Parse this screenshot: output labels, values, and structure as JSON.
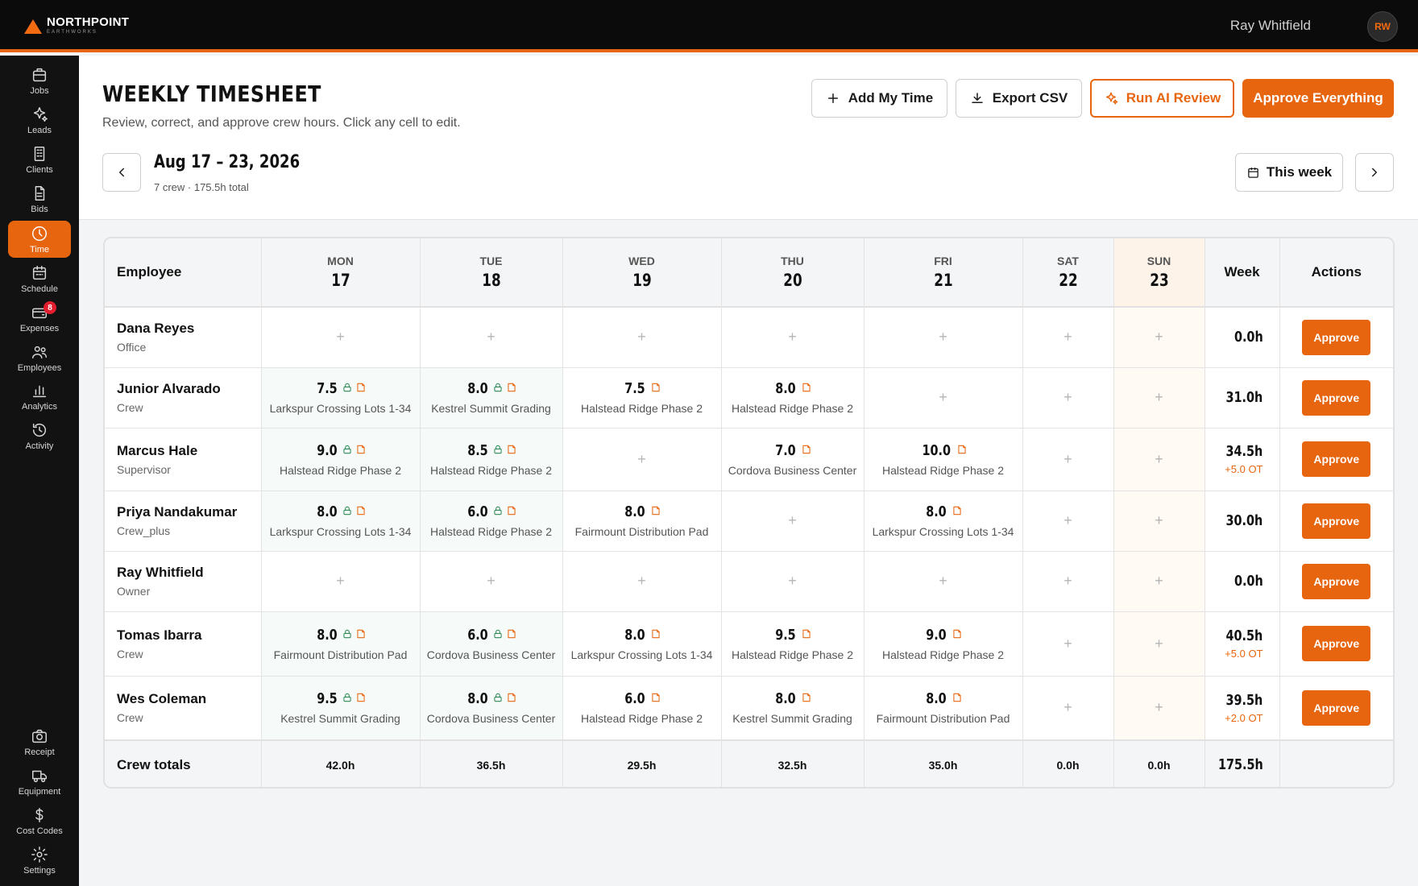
{
  "brand": {
    "name": "NORTHPOINT",
    "sub": "EARTHWORKS",
    "accent": "#e8650f"
  },
  "user": {
    "name": "Ray Whitfield",
    "initials": "RW"
  },
  "sidebar": {
    "items": [
      {
        "label": "Jobs",
        "icon": "briefcase-icon"
      },
      {
        "label": "Leads",
        "icon": "sparkle-icon"
      },
      {
        "label": "Clients",
        "icon": "building-icon"
      },
      {
        "label": "Bids",
        "icon": "document-icon"
      },
      {
        "label": "Time",
        "icon": "clock-icon",
        "active": true
      },
      {
        "label": "Schedule",
        "icon": "calendar-icon"
      },
      {
        "label": "Expenses",
        "icon": "wallet-icon",
        "badge": "8"
      },
      {
        "label": "Employees",
        "icon": "users-icon"
      },
      {
        "label": "Analytics",
        "icon": "bar-chart-icon"
      },
      {
        "label": "Activity",
        "icon": "history-icon"
      }
    ],
    "bottom": [
      {
        "label": "Receipt",
        "icon": "camera-icon"
      },
      {
        "label": "Equipment",
        "icon": "truck-icon"
      },
      {
        "label": "Cost Codes",
        "icon": "dollar-icon"
      },
      {
        "label": "Settings",
        "icon": "gear-icon"
      }
    ]
  },
  "page": {
    "title": "WEEKLY TIMESHEET",
    "subtitle": "Review, correct, and approve crew hours. Click any cell to edit.",
    "buttons": {
      "add_time": "Add My Time",
      "export": "Export CSV",
      "ai_review": "Run AI Review",
      "approve_all": "Approve Everything"
    },
    "date_range": "Aug 17 – 23, 2026",
    "date_meta": "7 crew · 175.5h total",
    "this_week": "This week"
  },
  "table": {
    "headers": {
      "employee": "Employee",
      "week": "Week",
      "actions": "Actions",
      "days": [
        {
          "name": "MON",
          "num": "17"
        },
        {
          "name": "TUE",
          "num": "18"
        },
        {
          "name": "WED",
          "num": "19"
        },
        {
          "name": "THU",
          "num": "20"
        },
        {
          "name": "FRI",
          "num": "21"
        },
        {
          "name": "SAT",
          "num": "22"
        },
        {
          "name": "SUN",
          "num": "23"
        }
      ]
    },
    "add_symbol": "+",
    "approve_label": "Approve",
    "rows": [
      {
        "name": "Dana Reyes",
        "role": "Office",
        "week": "0.0h",
        "ot": "",
        "days": [
          null,
          null,
          null,
          null,
          null,
          null,
          null
        ]
      },
      {
        "name": "Junior Alvarado",
        "role": "Crew",
        "week": "31.0h",
        "ot": "",
        "days": [
          {
            "h": "7.5",
            "job": "Larkspur Crossing Lots 1-34",
            "locked": true
          },
          {
            "h": "8.0",
            "job": "Kestrel Summit Grading",
            "locked": true
          },
          {
            "h": "7.5",
            "job": "Halstead Ridge Phase 2",
            "locked": false
          },
          {
            "h": "8.0",
            "job": "Halstead Ridge Phase 2",
            "locked": false
          },
          null,
          null,
          null
        ]
      },
      {
        "name": "Marcus Hale",
        "role": "Supervisor",
        "week": "34.5h",
        "ot": "+5.0 OT",
        "days": [
          {
            "h": "9.0",
            "job": "Halstead Ridge Phase 2",
            "locked": true
          },
          {
            "h": "8.5",
            "job": "Halstead Ridge Phase 2",
            "locked": true
          },
          null,
          {
            "h": "7.0",
            "job": "Cordova Business Center",
            "locked": false
          },
          {
            "h": "10.0",
            "job": "Halstead Ridge Phase 2",
            "locked": false
          },
          null,
          null
        ]
      },
      {
        "name": "Priya Nandakumar",
        "role": "Crew_plus",
        "week": "30.0h",
        "ot": "",
        "days": [
          {
            "h": "8.0",
            "job": "Larkspur Crossing Lots 1-34",
            "locked": true
          },
          {
            "h": "6.0",
            "job": "Halstead Ridge Phase 2",
            "locked": true
          },
          {
            "h": "8.0",
            "job": "Fairmount Distribution Pad",
            "locked": false
          },
          null,
          {
            "h": "8.0",
            "job": "Larkspur Crossing Lots 1-34",
            "locked": false
          },
          null,
          null
        ]
      },
      {
        "name": "Ray Whitfield",
        "role": "Owner",
        "week": "0.0h",
        "ot": "",
        "days": [
          null,
          null,
          null,
          null,
          null,
          null,
          null
        ]
      },
      {
        "name": "Tomas Ibarra",
        "role": "Crew",
        "week": "40.5h",
        "ot": "+5.0 OT",
        "days": [
          {
            "h": "8.0",
            "job": "Fairmount Distribution Pad",
            "locked": true
          },
          {
            "h": "6.0",
            "job": "Cordova Business Center",
            "locked": true
          },
          {
            "h": "8.0",
            "job": "Larkspur Crossing Lots 1-34",
            "locked": false
          },
          {
            "h": "9.5",
            "job": "Halstead Ridge Phase 2",
            "locked": false
          },
          {
            "h": "9.0",
            "job": "Halstead Ridge Phase 2",
            "locked": false
          },
          null,
          null
        ]
      },
      {
        "name": "Wes Coleman",
        "role": "Crew",
        "week": "39.5h",
        "ot": "+2.0 OT",
        "days": [
          {
            "h": "9.5",
            "job": "Kestrel Summit Grading",
            "locked": true
          },
          {
            "h": "8.0",
            "job": "Cordova Business Center",
            "locked": true
          },
          {
            "h": "6.0",
            "job": "Halstead Ridge Phase 2",
            "locked": false
          },
          {
            "h": "8.0",
            "job": "Kestrel Summit Grading",
            "locked": false
          },
          {
            "h": "8.0",
            "job": "Fairmount Distribution Pad",
            "locked": false
          },
          null,
          null
        ]
      }
    ],
    "totals": {
      "label": "Crew totals",
      "days": [
        "42.0h",
        "36.5h",
        "29.5h",
        "32.5h",
        "35.0h",
        "0.0h",
        "0.0h"
      ],
      "week": "175.5h"
    }
  }
}
